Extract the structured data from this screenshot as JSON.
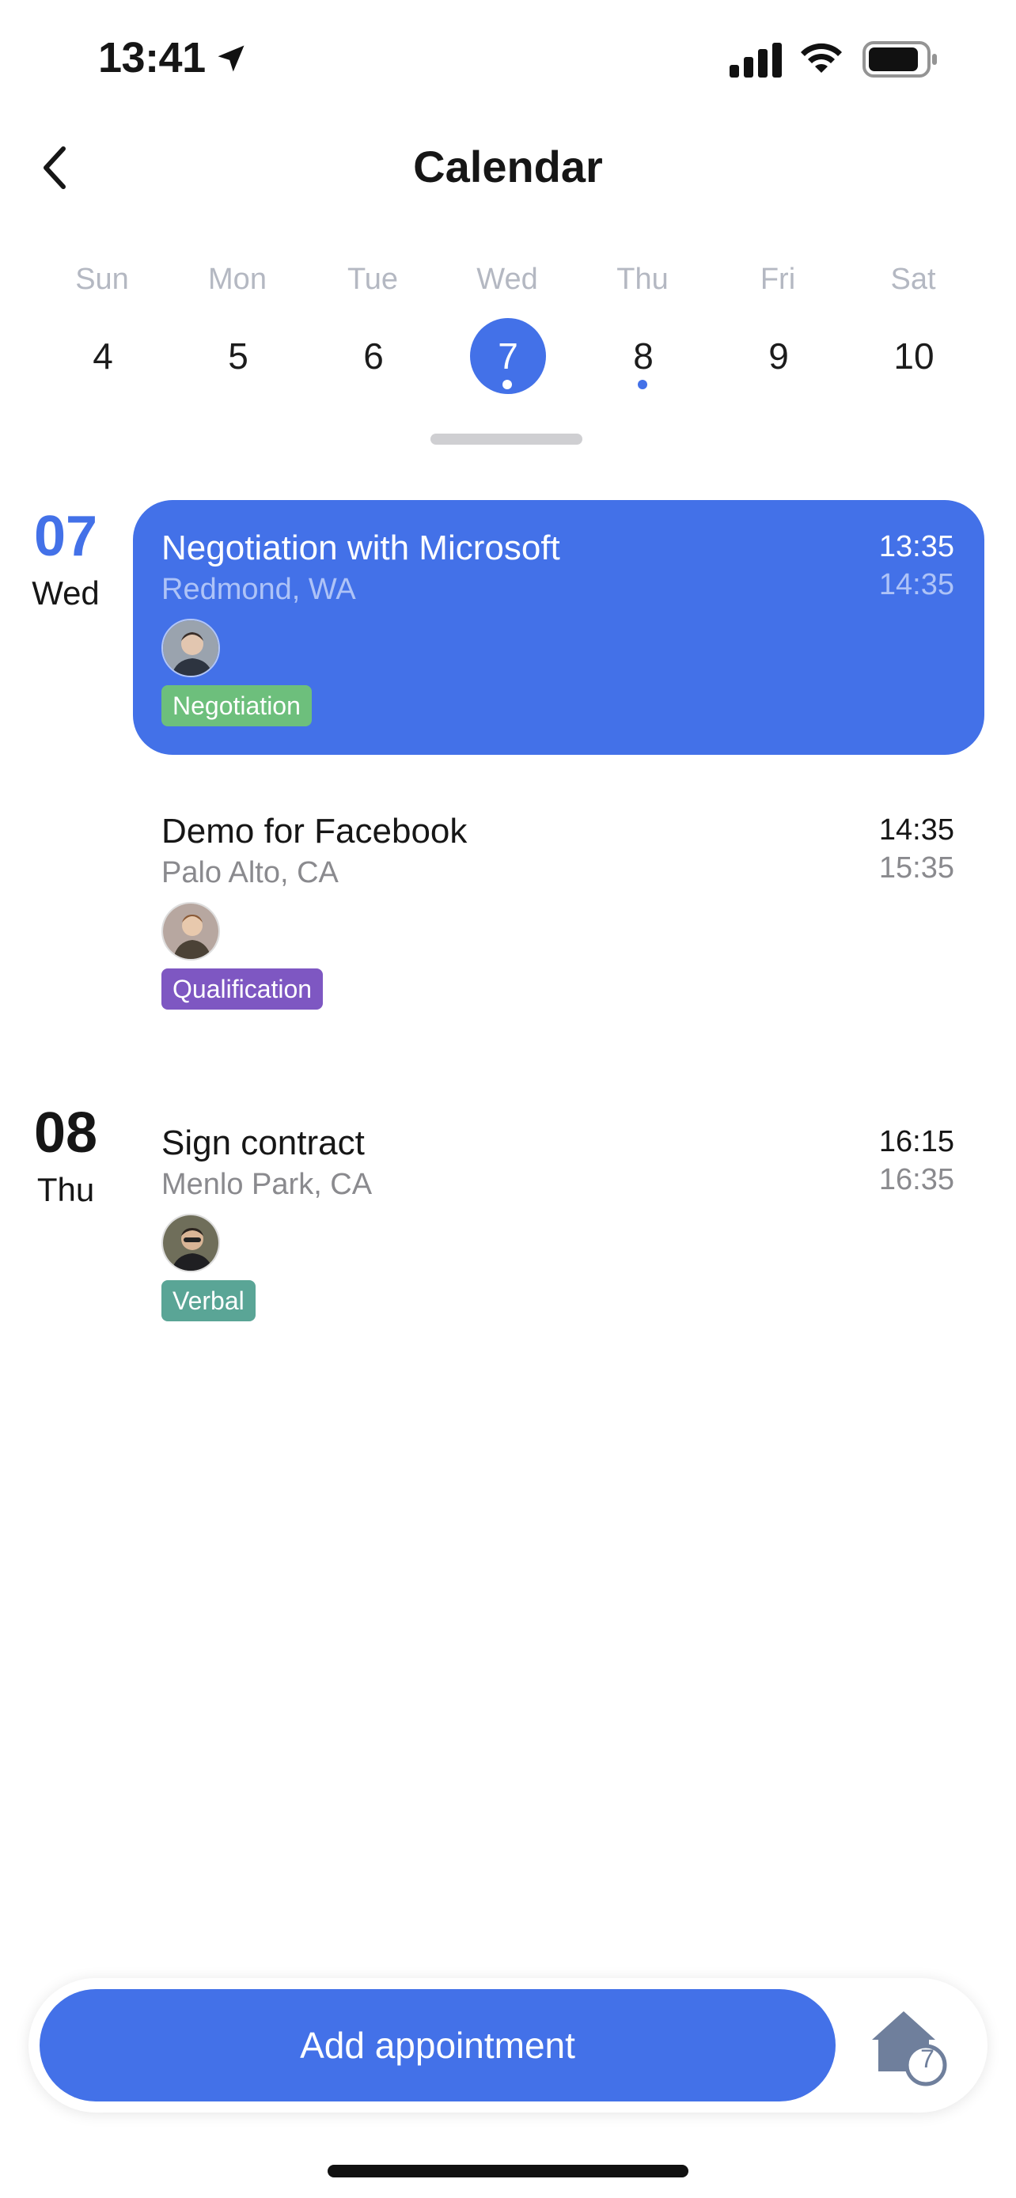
{
  "status": {
    "time": "13:41"
  },
  "header": {
    "title": "Calendar"
  },
  "week": {
    "days": [
      {
        "name": "Sun",
        "num": "4"
      },
      {
        "name": "Mon",
        "num": "5"
      },
      {
        "name": "Tue",
        "num": "6"
      },
      {
        "name": "Wed",
        "num": "7",
        "selected": true
      },
      {
        "name": "Thu",
        "num": "8",
        "has_event": true
      },
      {
        "name": "Fri",
        "num": "9"
      },
      {
        "name": "Sat",
        "num": "10"
      }
    ]
  },
  "agenda": {
    "groups": [
      {
        "date_num": "07",
        "weekday": "Wed",
        "events": [
          {
            "title": "Negotiation with Microsoft",
            "location": "Redmond, WA",
            "start": "13:35",
            "end": "14:35",
            "tag": "Negotiation",
            "tag_color": "#6dbf7c"
          },
          {
            "title": "Demo for Facebook",
            "location": "Palo Alto, CA",
            "start": "14:35",
            "end": "15:35",
            "tag": "Qualification",
            "tag_color": "#7e57c2"
          }
        ]
      },
      {
        "date_num": "08",
        "weekday": "Thu",
        "events": [
          {
            "title": "Sign contract",
            "location": "Menlo Park, CA",
            "start": "16:15",
            "end": "16:35",
            "tag": "Verbal",
            "tag_color": "#5aa596"
          }
        ]
      }
    ]
  },
  "bottom": {
    "add_label": "Add appointment",
    "home_badge": "7"
  },
  "colors": {
    "accent": "#4371e8",
    "muted": "#8a8a8e"
  }
}
